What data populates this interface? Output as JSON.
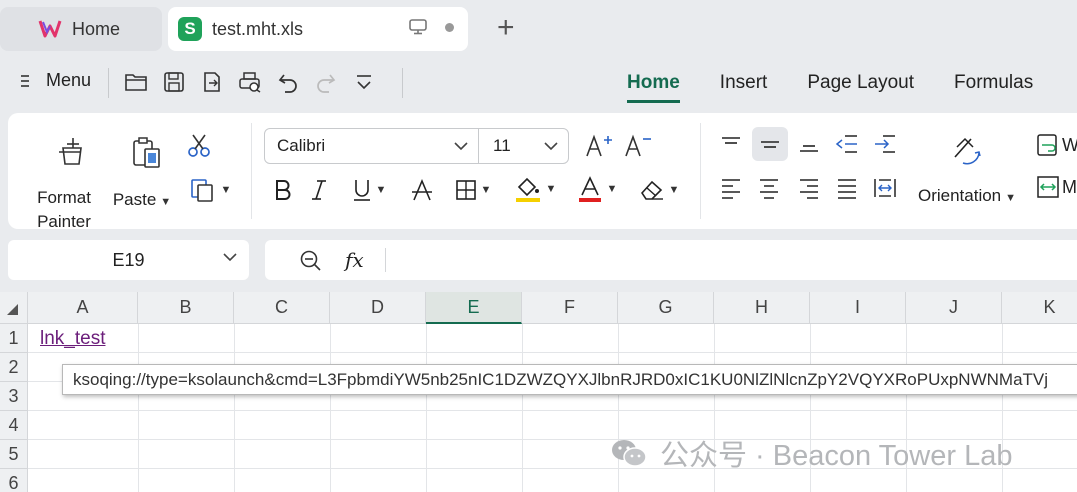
{
  "tabs": {
    "home_label": "Home",
    "file_label": "test.mht.xls",
    "new_tab_symbol": "+"
  },
  "quickbar": {
    "menu_label": "Menu",
    "ribbon_tabs": [
      "Home",
      "Insert",
      "Page Layout",
      "Formulas"
    ]
  },
  "ribbon": {
    "format_painter_line1": "Format",
    "format_painter_line2": "Painter",
    "paste_label": "Paste",
    "font_name": "Calibri",
    "font_size": "11",
    "orientation_label": "Orientation",
    "wrap_partial": "W",
    "merge_partial": "M"
  },
  "formula_bar": {
    "cell_ref": "E19",
    "fx_label": "fx",
    "formula_value": ""
  },
  "sheet": {
    "columns": [
      "A",
      "B",
      "C",
      "D",
      "E",
      "F",
      "G",
      "H",
      "I",
      "J",
      "K"
    ],
    "selected_column": "E",
    "rows": [
      "1",
      "2",
      "3",
      "4",
      "5",
      "6"
    ],
    "a1_value": "lnk_test",
    "tooltip_text": "ksoqing://type=ksolaunch&cmd=L3FpbmdiYW5nb25nIC1DZWZQYXJlbnRJRD0xIC1KU0NlZlNlcnZpY2VQYXRoPUxpNWNMaTVj"
  },
  "watermark": {
    "text": "公众号 · Beacon Tower Lab"
  },
  "colors": {
    "accent": "#146b50",
    "link": "#6b1d7a",
    "sheet_logo": "#1fa25a",
    "highlight_bar": "#f5d000",
    "font_color_bar": "#e02020"
  }
}
